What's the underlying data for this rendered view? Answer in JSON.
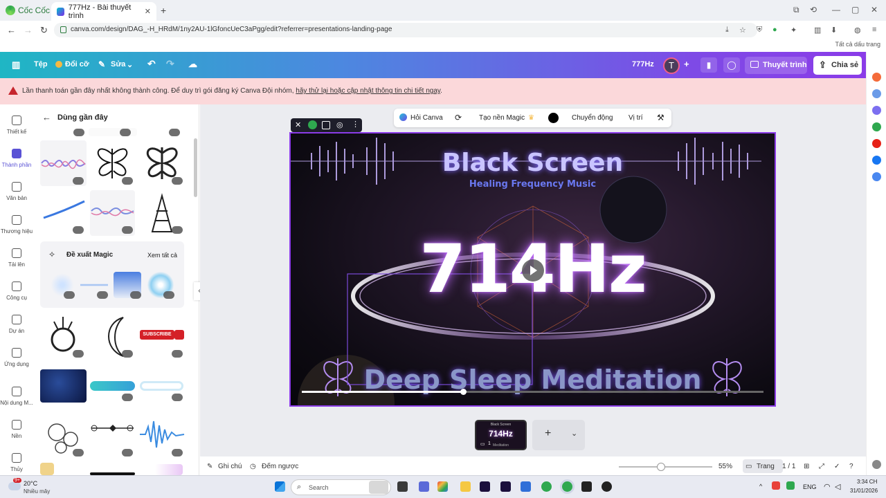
{
  "browser": {
    "brand": "Cốc Cốc",
    "tab_title": "777Hz - Bài thuyết trình",
    "url": "canva.com/design/DAG_-H_HRdM/1ny2AU-1lGfoncUeC3aPgg/edit?referrer=presentations-landing-page",
    "all_bookmarks": "Tất cả dấu trang"
  },
  "header": {
    "file": "Tệp",
    "resize": "Đổi cỡ",
    "edit": "Sửa",
    "doc_title": "777Hz",
    "avatar": "T",
    "present": "Thuyết trình",
    "share": "Chia sẻ"
  },
  "alert": {
    "text": "Lần thanh toán gần đây nhất không thành công. Để duy trì gói đăng ký Canva Đội nhóm, ",
    "link": "hãy thử lại hoặc cập nhật thông tin chi tiết ngay",
    "end": "."
  },
  "rail": [
    "Thiết kế",
    "Thành phần",
    "Văn bản",
    "Thương hiệu",
    "Tải lên",
    "Công cụ",
    "Dự án",
    "Ứng dụng",
    "Nội dung M...",
    "Nền",
    "Thủy"
  ],
  "panel": {
    "title": "Dùng gần đây",
    "magic_title": "Đề xuất Magic",
    "see_all": "Xem tất cả",
    "subscribe": "SUBSCRIBE"
  },
  "toolbar": {
    "ask": "Hỏi Canva",
    "magic_bg": "Tạo nền Magic",
    "animate": "Chuyển động",
    "position": "Vị trí"
  },
  "slide": {
    "title": "Black Screen",
    "subtitle": "Healing Frequency Music",
    "freq": "714Hz",
    "bottom": "Deep Sleep Meditation",
    "progress": 0.35
  },
  "thumb": {
    "title": "Black Screen",
    "freq": "714Hz",
    "bottom": "Meditation",
    "index": "1"
  },
  "footer": {
    "notes": "Ghi chú",
    "timer": "Đếm ngược",
    "zoom": "55%",
    "zoom_level": 0.45,
    "pages_label": "Trang",
    "page_count": "1 / 1"
  },
  "taskbar": {
    "weather_temp": "20°C",
    "weather_desc": "Nhiều mây",
    "badge": "9+",
    "search": "Search",
    "lang": "ENG",
    "time": "3:34 CH",
    "date": "31/01/2026"
  },
  "colors": {
    "accent": "#8b3ce8",
    "teal": "#1fb6c4",
    "alert_bg": "#fbd8da"
  }
}
